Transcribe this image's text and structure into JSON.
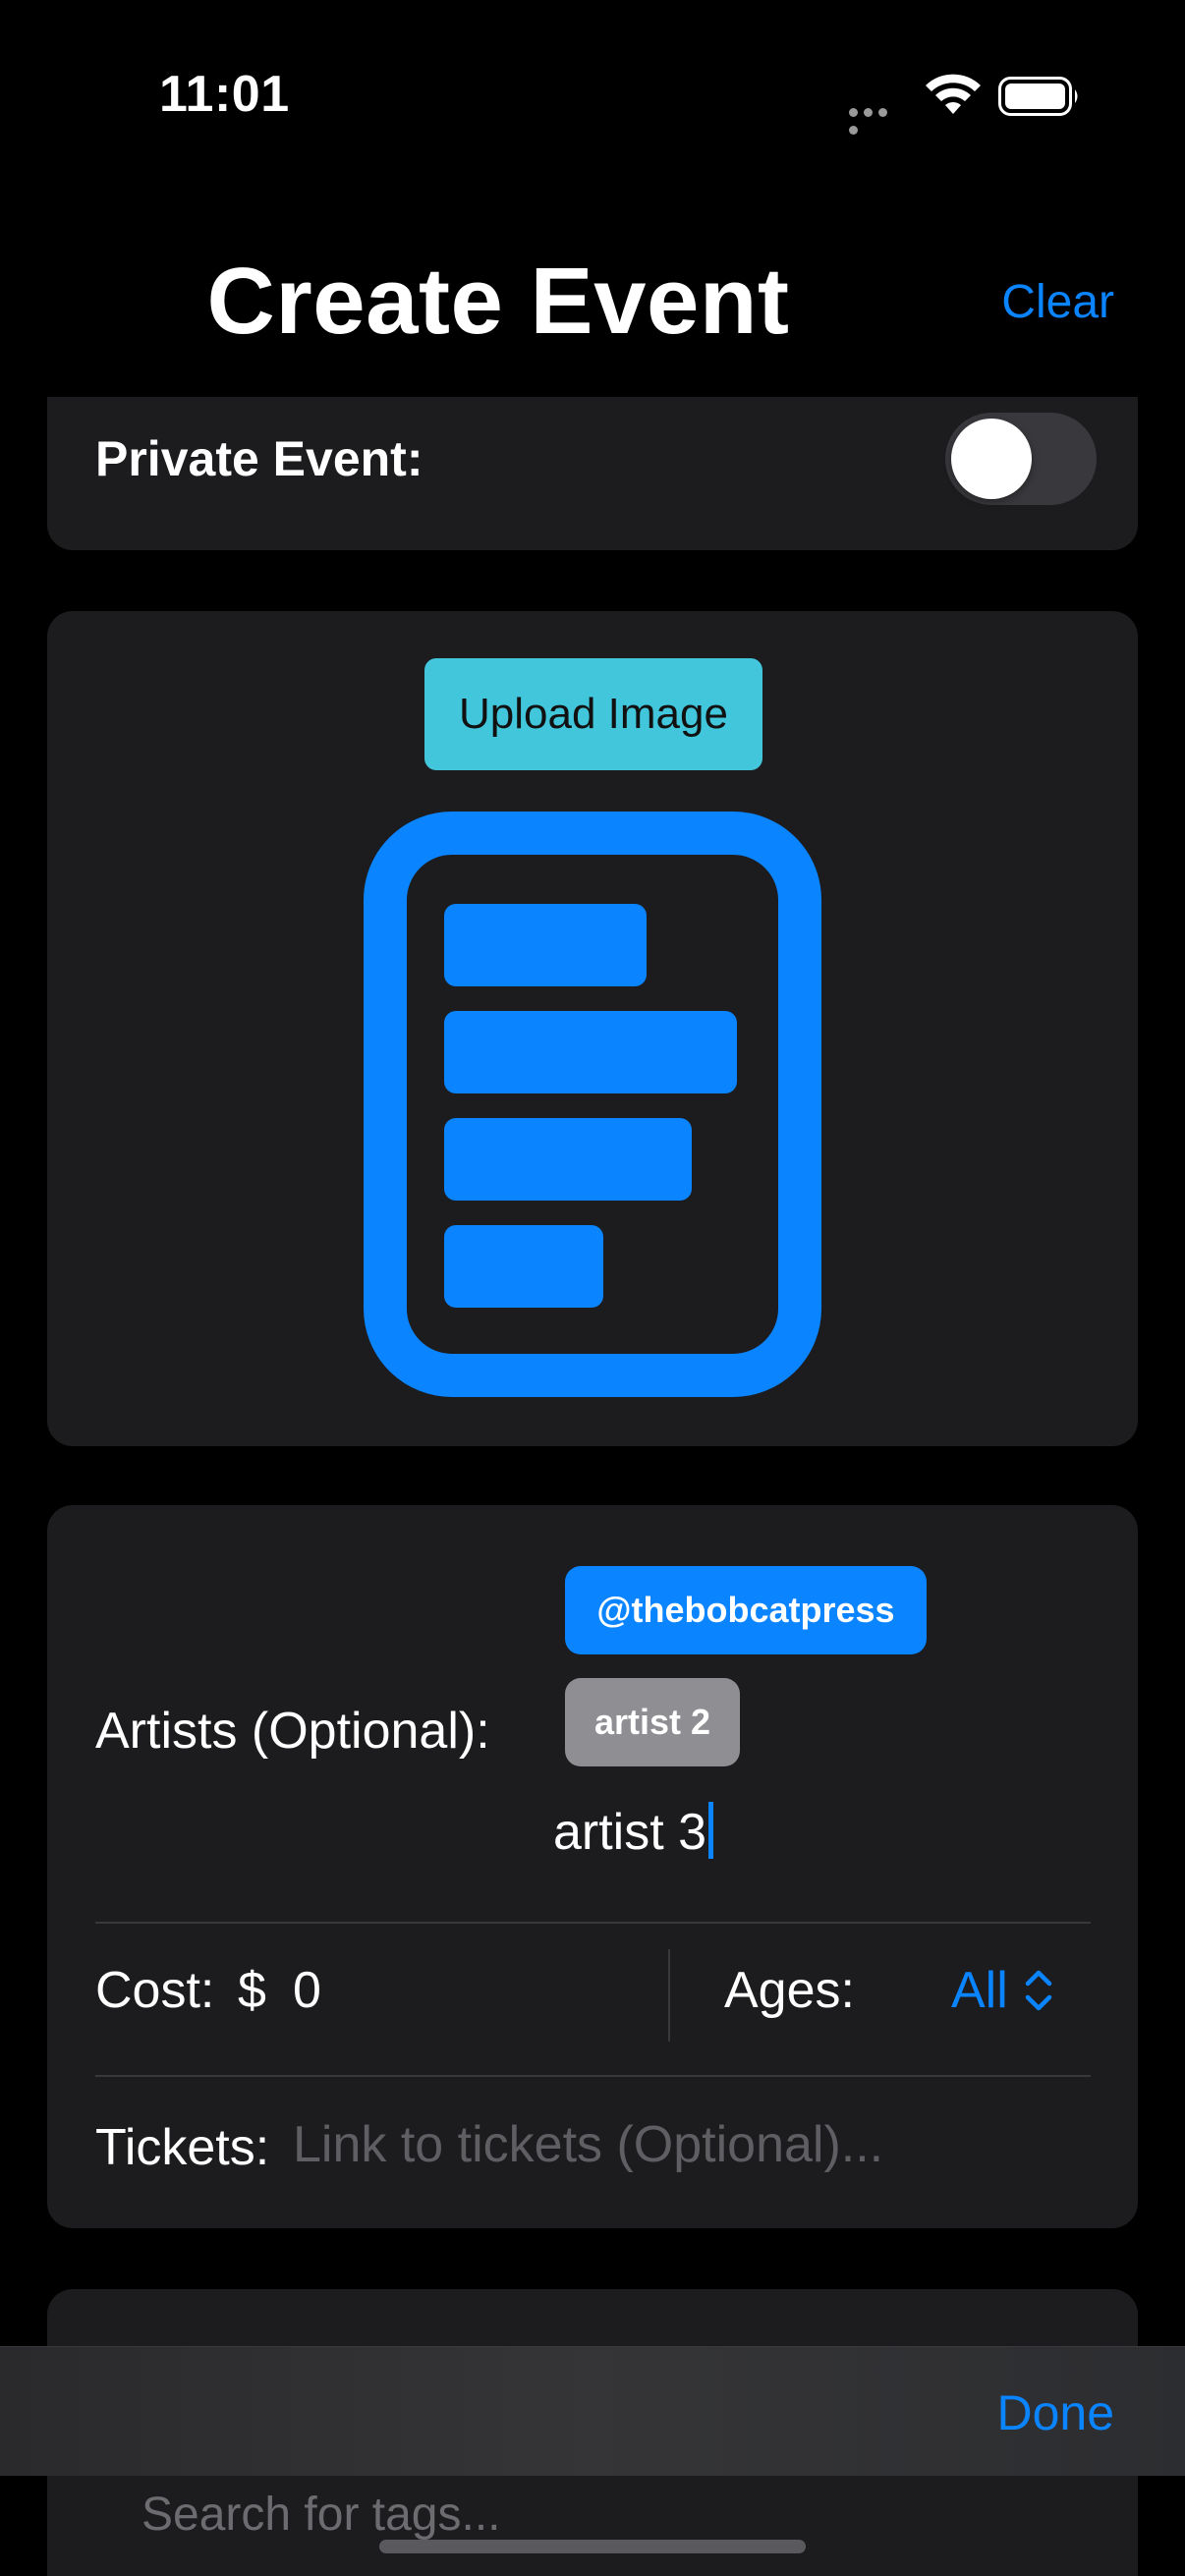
{
  "status_bar": {
    "time": "11:01"
  },
  "header": {
    "title": "Create Event",
    "clear_label": "Clear"
  },
  "private_event": {
    "label": "Private Event:",
    "enabled": false
  },
  "image_section": {
    "upload_label": "Upload Image",
    "icon": "document-list-icon"
  },
  "details": {
    "artists_label": "Artists (Optional):",
    "artist_tags": [
      "@thebobcatpress",
      "artist 2"
    ],
    "artist_input_value": "artist 3",
    "cost_label": "Cost:",
    "currency": "$",
    "cost_value": "0",
    "ages_label": "Ages:",
    "ages_value": "All",
    "tickets_label": "Tickets:",
    "tickets_placeholder": "Link to tickets (Optional)..."
  },
  "tags": {
    "search_placeholder": "Search for tags..."
  },
  "keyboard_accessory": {
    "done_label": "Done"
  },
  "colors": {
    "accent": "#0a84ff",
    "upload_button": "#41c6dc",
    "card_background": "#1c1c1e",
    "secondary_tag": "#8e8e93"
  }
}
